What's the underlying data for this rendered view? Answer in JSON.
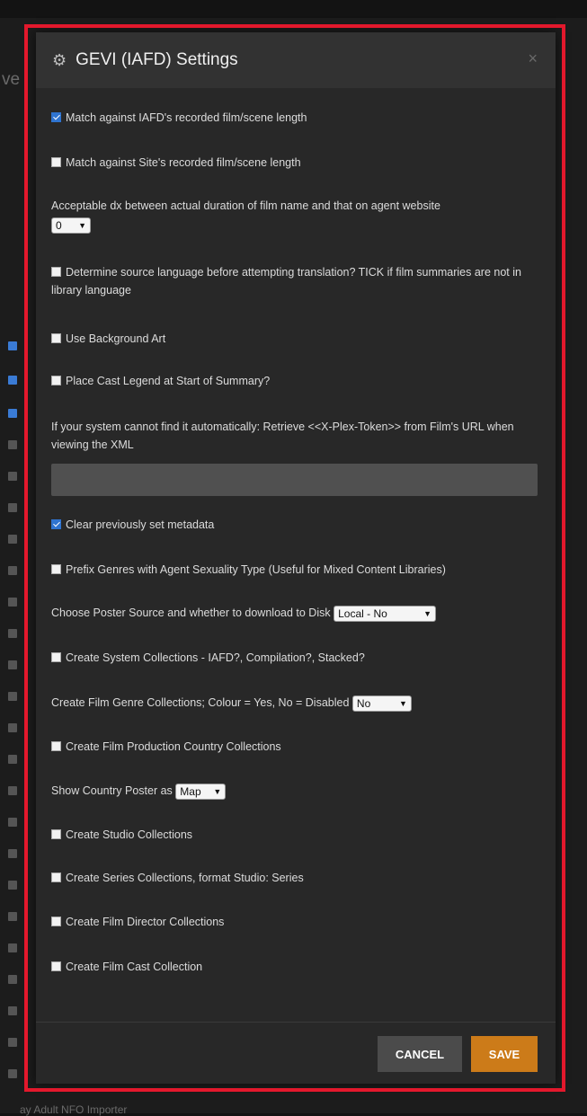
{
  "dialog": {
    "title": "GEVI (IAFD) Settings",
    "close_glyph": "×",
    "icon": "gear-icon"
  },
  "settings": {
    "match_iafd_length": {
      "label": "Match against IAFD's recorded film/scene length",
      "checked": true
    },
    "match_site_length": {
      "label": "Match against Site's recorded film/scene length",
      "checked": false
    },
    "duration_dx": {
      "label": "Acceptable dx between actual duration of film name and that on agent website",
      "value": "0"
    },
    "determine_language": {
      "label": "Determine source language before attempting translation? TICK if film summaries are not in library language",
      "checked": false
    },
    "background_art": {
      "label": "Use Background Art",
      "checked": false
    },
    "cast_legend": {
      "label": "Place Cast Legend at Start of Summary?",
      "checked": false
    },
    "plex_token": {
      "label": "If your system cannot find it automatically: Retrieve <<X-Plex-Token>> from Film's URL when viewing the XML",
      "value": ""
    },
    "clear_metadata": {
      "label": "Clear previously set metadata",
      "checked": true
    },
    "prefix_genres": {
      "label": "Prefix Genres with Agent Sexuality Type (Useful for Mixed Content Libraries)",
      "checked": false
    },
    "poster_source": {
      "label": "Choose Poster Source and whether to download to Disk",
      "value": "Local - No"
    },
    "system_collections": {
      "label": "Create System Collections - IAFD?, Compilation?, Stacked?",
      "checked": false
    },
    "genre_collections": {
      "label": "Create Film Genre Collections; Colour = Yes, No = Disabled",
      "value": "No"
    },
    "country_collections": {
      "label": "Create Film Production Country Collections",
      "checked": false
    },
    "country_poster": {
      "label": "Show Country Poster as",
      "value": "Map"
    },
    "studio_collections": {
      "label": "Create Studio Collections",
      "checked": false
    },
    "series_collections": {
      "label": "Create Series Collections, format Studio: Series",
      "checked": false
    },
    "director_collections": {
      "label": "Create Film Director Collections",
      "checked": false
    },
    "cast_collection": {
      "label": "Create Film Cast Collection",
      "checked": false
    }
  },
  "footer": {
    "cancel_label": "CANCEL",
    "save_label": "SAVE"
  },
  "background": {
    "partial_title": "ve",
    "partial_footer_text": "ay Adult NFO Importer"
  },
  "colors": {
    "accent_save": "#cc7b19",
    "checkbox_checked": "#2f74d0",
    "highlight_border": "#e3182c"
  }
}
